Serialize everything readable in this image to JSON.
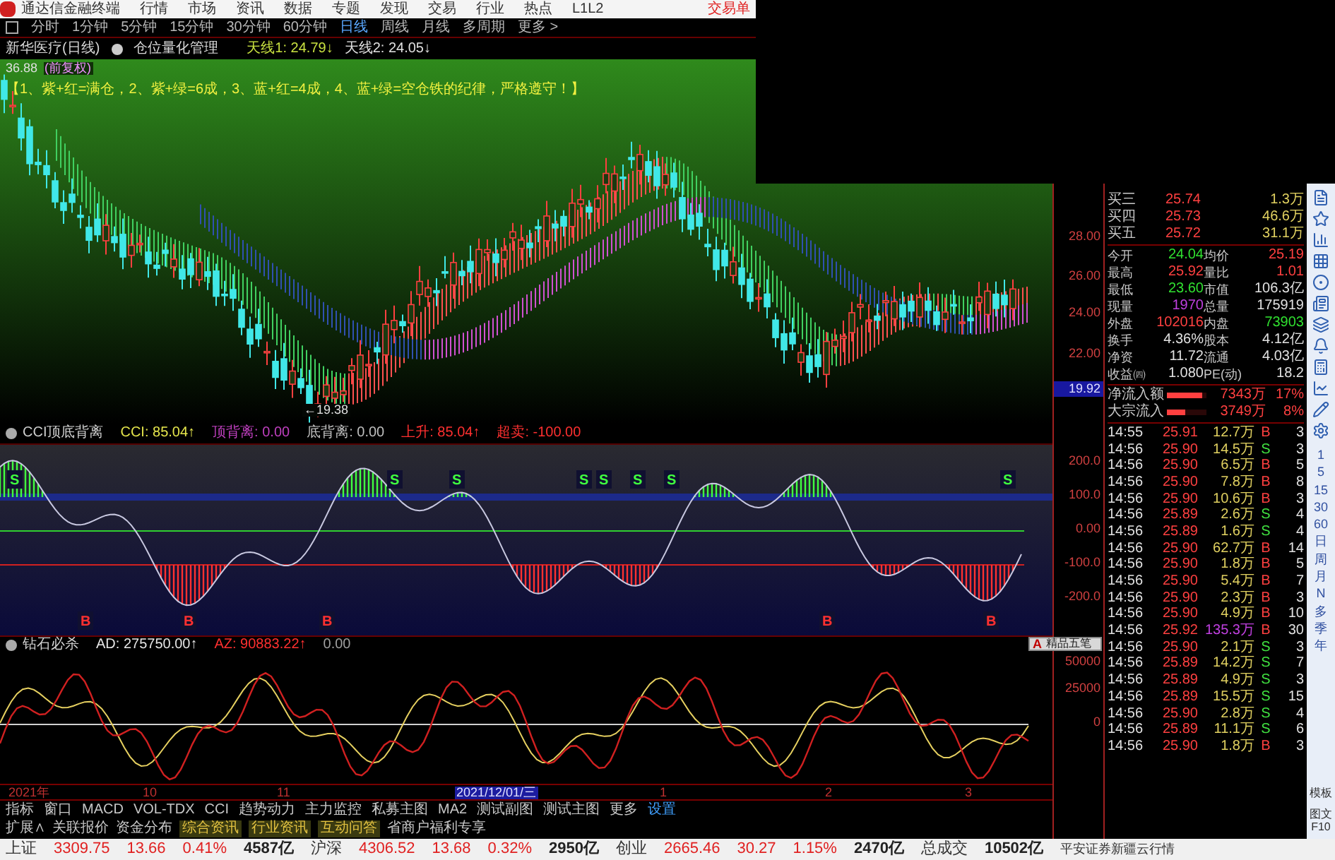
{
  "menu_bar": {
    "app_name": "通达信金融终端",
    "items": [
      "行情",
      "市场",
      "资讯",
      "数据",
      "专题",
      "发现",
      "交易",
      "行业",
      "热点",
      "L1L2"
    ],
    "trade_button": "交易单"
  },
  "period_tabs": [
    {
      "label": "分时",
      "selected": false
    },
    {
      "label": "1分钟",
      "selected": false
    },
    {
      "label": "5分钟",
      "selected": false
    },
    {
      "label": "15分钟",
      "selected": false
    },
    {
      "label": "30分钟",
      "selected": false
    },
    {
      "label": "60分钟",
      "selected": false
    },
    {
      "label": "日线",
      "selected": true
    },
    {
      "label": "周线",
      "selected": false
    },
    {
      "label": "月线",
      "selected": false
    },
    {
      "label": "多周期",
      "selected": false
    },
    {
      "label": "更多 >",
      "selected": false
    }
  ],
  "stock_bar": {
    "name": "新华医疗(日线)",
    "tool": "仓位量化管理",
    "values": [
      {
        "text": "天线1: 24.79↓",
        "color": "#c8e040"
      },
      {
        "text": "天线2: 24.05↓",
        "color": "#e0e0e0"
      }
    ]
  },
  "main_chart": {
    "top_price": "36.88",
    "adjust": "(前复权)",
    "legend": "【1、紫+红=满仓，2、紫+绿=6成，3、蓝+红=4成，4、蓝+绿=空仓铁的纪律，严格遵守！】",
    "low_label": "←19.38",
    "axis_labels": [
      "28.00",
      "26.00",
      "24.00",
      "22.00"
    ],
    "current_price": "19.92"
  },
  "cci_panel": {
    "title": "CCI顶底背离",
    "fields": [
      {
        "text": "CCI: 85.04↑",
        "color": "#e6e64c"
      },
      {
        "text": "顶背离: 0.00",
        "color": "#c040c0"
      },
      {
        "text": "底背离: 0.00",
        "color": "#c0c0c0"
      },
      {
        "text": "上升: 85.04↑",
        "color": "#ff3030"
      },
      {
        "text": "超卖: -100.00",
        "color": "#ff3030"
      }
    ],
    "signals": [
      {
        "text": "S",
        "kind": "sell"
      },
      {
        "text": "B",
        "kind": "buy"
      },
      {
        "text": "B",
        "kind": "buy"
      },
      {
        "text": "B",
        "kind": "buy"
      },
      {
        "text": "S",
        "kind": "sell"
      },
      {
        "text": "S",
        "kind": "sell"
      },
      {
        "text": "S",
        "kind": "sell"
      },
      {
        "text": "S",
        "kind": "sell"
      },
      {
        "text": "S",
        "kind": "sell"
      },
      {
        "text": "S",
        "kind": "sell"
      },
      {
        "text": "B",
        "kind": "buy"
      },
      {
        "text": "B",
        "kind": "buy"
      },
      {
        "text": "S",
        "kind": "sell"
      }
    ],
    "axis_labels": [
      "200.0",
      "100.0",
      "0.00",
      "-100.0",
      "-200.0"
    ]
  },
  "ad_panel": {
    "title": "钻石必杀",
    "fields": [
      {
        "text": "AD: 275750.00↑",
        "color": "#e6e6e6"
      },
      {
        "text": "AZ: 90883.22↑",
        "color": "#ff3030"
      },
      {
        "text": "0.00",
        "color": "#a0a0a0"
      }
    ],
    "axis_labels": [
      "50000",
      "25000",
      "0"
    ]
  },
  "ime_toolbar": {
    "mode": "A",
    "name": "精品五笔"
  },
  "date_axis": [
    {
      "label": "2021年",
      "selected": false
    },
    {
      "label": "10",
      "selected": false
    },
    {
      "label": "11",
      "selected": false
    },
    {
      "label": "2021/12/01/三",
      "selected": true
    },
    {
      "label": "1",
      "selected": false
    },
    {
      "label": "2",
      "selected": false
    },
    {
      "label": "3",
      "selected": false
    }
  ],
  "indicator_tabs": [
    {
      "label": "指标",
      "selected": false
    },
    {
      "label": "窗口",
      "selected": false
    },
    {
      "label": "MACD",
      "selected": false
    },
    {
      "label": "VOL-TDX",
      "selected": false
    },
    {
      "label": "CCI",
      "selected": false
    },
    {
      "label": "趋势动力",
      "selected": false
    },
    {
      "label": "主力监控",
      "selected": false
    },
    {
      "label": "私募主图",
      "selected": false
    },
    {
      "label": "MA2",
      "selected": false
    },
    {
      "label": "测试副图",
      "selected": false
    },
    {
      "label": "测试主图",
      "selected": false
    },
    {
      "label": "更多",
      "selected": false
    },
    {
      "label": "设置",
      "selected": true
    }
  ],
  "info_tabs": [
    {
      "label": "扩展∧",
      "kind": "plain"
    },
    {
      "label": "关联报价",
      "kind": "plain"
    },
    {
      "label": "资金分布",
      "kind": "plain"
    },
    {
      "label": "综合资讯",
      "kind": "tag"
    },
    {
      "label": "行业资讯",
      "kind": "tag"
    },
    {
      "label": "互动问答",
      "kind": "tag"
    },
    {
      "label": "省商户福利专享",
      "kind": "plain"
    }
  ],
  "quote": {
    "book": [
      {
        "label": "买三",
        "price": "25.74",
        "volume": "1.3万"
      },
      {
        "label": "买四",
        "price": "25.73",
        "volume": "46.6万"
      },
      {
        "label": "买五",
        "price": "25.72",
        "volume": "31.1万"
      }
    ],
    "stats": [
      {
        "cells": [
          {
            "text": "今开",
            "color": "#c8c8c8"
          },
          {
            "text": "24.04",
            "color": "#30e030"
          },
          {
            "text": "均价",
            "color": "#c8c8c8"
          },
          {
            "text": "25.19",
            "color": "#ff4040"
          }
        ]
      },
      {
        "cells": [
          {
            "text": "最高",
            "color": "#c8c8c8"
          },
          {
            "text": "25.92",
            "color": "#ff4040"
          },
          {
            "text": "量比",
            "color": "#c8c8c8"
          },
          {
            "text": "1.01",
            "color": "#ff4040"
          }
        ]
      },
      {
        "cells": [
          {
            "text": "最低",
            "color": "#c8c8c8"
          },
          {
            "text": "23.60",
            "color": "#30e030"
          },
          {
            "text": "市值",
            "color": "#c8c8c8"
          },
          {
            "text": "106.3亿",
            "color": "#e0e0e0"
          }
        ]
      },
      {
        "cells": [
          {
            "text": "现量",
            "color": "#c8c8c8"
          },
          {
            "text": "1970",
            "color": "#c040e0"
          },
          {
            "text": "总量",
            "color": "#c8c8c8"
          },
          {
            "text": "175919",
            "color": "#e0e0e0"
          }
        ]
      },
      {
        "cells": [
          {
            "text": "外盘",
            "color": "#c8c8c8"
          },
          {
            "text": "102016",
            "color": "#ff4040"
          },
          {
            "text": "内盘",
            "color": "#c8c8c8"
          },
          {
            "text": "73903",
            "color": "#30e030"
          }
        ]
      },
      {
        "cells": [
          {
            "text": "换手",
            "color": "#c8c8c8"
          },
          {
            "text": "4.36%",
            "color": "#e0e0e0"
          },
          {
            "text": "股本",
            "color": "#c8c8c8"
          },
          {
            "text": "4.12亿",
            "color": "#e0e0e0"
          }
        ]
      },
      {
        "cells": [
          {
            "text": "净资",
            "color": "#c8c8c8"
          },
          {
            "text": "11.72",
            "color": "#e0e0e0"
          },
          {
            "text": "流通",
            "color": "#c8c8c8"
          },
          {
            "text": "4.03亿",
            "color": "#e0e0e0"
          }
        ]
      },
      {
        "cells": [
          {
            "text": "收益㈣",
            "color": "#c8c8c8"
          },
          {
            "text": "1.080",
            "color": "#e0e0e0"
          },
          {
            "text": "PE(动)",
            "color": "#c8c8c8"
          },
          {
            "text": "18.2",
            "color": "#e0e0e0"
          }
        ]
      }
    ],
    "flows": [
      {
        "label": "净流入额",
        "level": 0.9,
        "amount": "7343万",
        "percent": "17%"
      },
      {
        "label": "大宗流入",
        "level": 0.45,
        "amount": "3749万",
        "percent": "8%"
      }
    ],
    "ticks": [
      {
        "time": "14:55",
        "price": "25.91",
        "volume": "12.7万",
        "side": "B",
        "kind": "buy",
        "large": false,
        "count": "3"
      },
      {
        "time": "14:56",
        "price": "25.90",
        "volume": "14.5万",
        "side": "S",
        "kind": "sell",
        "large": false,
        "count": "3"
      },
      {
        "time": "14:56",
        "price": "25.90",
        "volume": "6.5万",
        "side": "B",
        "kind": "buy",
        "large": false,
        "count": "5"
      },
      {
        "time": "14:56",
        "price": "25.90",
        "volume": "7.8万",
        "side": "B",
        "kind": "buy",
        "large": false,
        "count": "8"
      },
      {
        "time": "14:56",
        "price": "25.90",
        "volume": "10.6万",
        "side": "B",
        "kind": "buy",
        "large": false,
        "count": "3"
      },
      {
        "time": "14:56",
        "price": "25.89",
        "volume": "2.6万",
        "side": "S",
        "kind": "sell",
        "large": false,
        "count": "4"
      },
      {
        "time": "14:56",
        "price": "25.89",
        "volume": "1.6万",
        "side": "S",
        "kind": "sell",
        "large": false,
        "count": "4"
      },
      {
        "time": "14:56",
        "price": "25.90",
        "volume": "62.7万",
        "side": "B",
        "kind": "buy",
        "large": false,
        "count": "14"
      },
      {
        "time": "14:56",
        "price": "25.90",
        "volume": "1.8万",
        "side": "B",
        "kind": "buy",
        "large": false,
        "count": "5"
      },
      {
        "time": "14:56",
        "price": "25.90",
        "volume": "5.4万",
        "side": "B",
        "kind": "buy",
        "large": false,
        "count": "7"
      },
      {
        "time": "14:56",
        "price": "25.90",
        "volume": "2.3万",
        "side": "B",
        "kind": "buy",
        "large": false,
        "count": "3"
      },
      {
        "time": "14:56",
        "price": "25.90",
        "volume": "4.9万",
        "side": "B",
        "kind": "buy",
        "large": false,
        "count": "10"
      },
      {
        "time": "14:56",
        "price": "25.92",
        "volume": "135.3万",
        "side": "B",
        "kind": "buy",
        "large": true,
        "count": "30"
      },
      {
        "time": "14:56",
        "price": "25.90",
        "volume": "2.1万",
        "side": "S",
        "kind": "sell",
        "large": false,
        "count": "3"
      },
      {
        "time": "14:56",
        "price": "25.89",
        "volume": "14.2万",
        "side": "S",
        "kind": "sell",
        "large": false,
        "count": "7"
      },
      {
        "time": "14:56",
        "price": "25.89",
        "volume": "4.9万",
        "side": "S",
        "kind": "sell",
        "large": false,
        "count": "3"
      },
      {
        "time": "14:56",
        "price": "25.89",
        "volume": "15.5万",
        "side": "S",
        "kind": "sell",
        "large": false,
        "count": "15"
      },
      {
        "time": "14:56",
        "price": "25.90",
        "volume": "2.8万",
        "side": "S",
        "kind": "sell",
        "large": false,
        "count": "4"
      },
      {
        "time": "14:56",
        "price": "25.89",
        "volume": "11.1万",
        "side": "S",
        "kind": "sell",
        "large": false,
        "count": "6"
      },
      {
        "time": "14:56",
        "price": "25.90",
        "volume": "1.8万",
        "side": "B",
        "kind": "buy",
        "large": false,
        "count": "3"
      }
    ]
  },
  "side_toolbar": {
    "periods": [
      "1",
      "5",
      "15",
      "30",
      "60",
      "日",
      "周",
      "月",
      "N",
      "多",
      "季",
      "年"
    ],
    "buttons": [
      "模板",
      "图文F10"
    ]
  },
  "status_bar": {
    "indices": [
      {
        "name": "上证",
        "value": "3309.75",
        "change": "13.66",
        "percent": "0.41%",
        "amount": "4587亿"
      },
      {
        "name": "沪深",
        "value": "4306.52",
        "change": "13.68",
        "percent": "0.32%",
        "amount": "2950亿"
      },
      {
        "name": "创业",
        "value": "2665.46",
        "change": "30.27",
        "percent": "1.15%",
        "amount": "2470亿"
      }
    ],
    "total_label": "总成交",
    "total": "10502亿",
    "broker": "平安证券新疆云行情"
  }
}
